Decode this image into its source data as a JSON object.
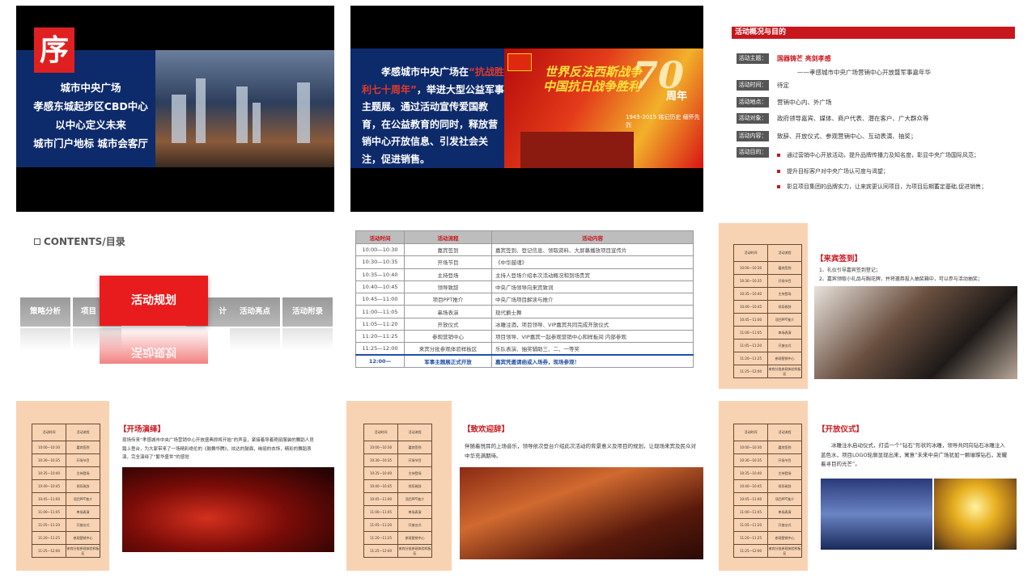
{
  "slide1": {
    "badge": "序",
    "lines": [
      "城市中央广场",
      "孝感东城起步区CBD中心",
      "以中心定义未来",
      "城市门户地标  城市会客厅"
    ]
  },
  "slide2": {
    "text_before": "孝感城市中央广场在",
    "text_red": "“抗战胜利七十周年”",
    "text_after": "，举进大型公益军事主题展。通过活动宣传爱国教育，在公益教育的同时，释放营销中心开放信息、引发社会关注，促进销售。",
    "poster_line1": "世界反法西斯战争",
    "poster_line2": "中国抗日战争胜利",
    "poster_number": "70",
    "poster_suffix": "周年",
    "poster_years": "1945-2015",
    "poster_slogan": "铭记历史 缅怀先烈"
  },
  "slide3": {
    "header": "活动概况与目的",
    "theme_label": "活动主题：",
    "theme_value": "国器铸芒  亮剑孝感",
    "theme_sub": "——孝感城市中央广场营销中心开放暨军事嘉年华",
    "rows": [
      {
        "label": "活动时间：",
        "value": "待定"
      },
      {
        "label": "活动地点：",
        "value": "营销中心内、外广场"
      },
      {
        "label": "活动对象：",
        "value": "政府领导嘉宾、媒体、商户代表、潜在客户、广大群众等"
      },
      {
        "label": "活动内容：",
        "value": "致辞、开放仪式、参观营销中心、互动表演、抽奖；"
      },
      {
        "label": "活动目的：",
        "value": ""
      }
    ],
    "bullets": [
      "通过营销中心开放活动，提升品牌传播力及知名度，彰显中央广场国际风范；",
      "提升目标客户对中央广场认可度与渴望；",
      "彰显项目集团的品牌实力，让来宾更认同项目，为项目后期蓄定基础,促进销售；"
    ]
  },
  "slide4": {
    "title": "CONTENTS/目录",
    "tabs": [
      "策略分析",
      "项目",
      "计",
      "活动亮点",
      "活动附录"
    ],
    "active_tab": "活动规划"
  },
  "slide5": {
    "headers": [
      "活动时间",
      "活动流程",
      "活动内容"
    ],
    "rows": [
      [
        "10:00—10:30",
        "嘉宾签到",
        "嘉宾签到、登记信息、领取资料、大屏幕播放项目宣传片"
      ],
      [
        "10:30—10:35",
        "开场节目",
        "《中华鼓魂》"
      ],
      [
        "10:35—10:40",
        "主持登场",
        "主持人登场介绍本次活动概况和到场贵宾"
      ],
      [
        "10:40—10:45",
        "领导致辞",
        "中央广场领导向来宾致词"
      ],
      [
        "10:45—11:00",
        "项目PPT推介",
        "中央广场项目解读与推介"
      ],
      [
        "11:00—11:05",
        "串场表演",
        "现代爵士舞"
      ],
      [
        "11:05—11:20",
        "开放仪式",
        "冰雕注酒，项目领导、VIP嘉宾共同完成开放仪式"
      ],
      [
        "11:20—11:25",
        "参观营销中心",
        "项目领导、VIP嘉宾一起参观营销中心和样板间 内部参观"
      ],
      [
        "11:25—12:00",
        "来宾分批参观体验样板区",
        "乐队表演、抽奖辅助三、二、一等奖"
      ]
    ],
    "last_row": [
      "12:00—",
      "军事主题展正式开放",
      "嘉宾凭邀请函或入场券，现场参观！"
    ]
  },
  "schedule_mini": {
    "headers": [
      "活动时间",
      "活动流程"
    ],
    "rows": [
      [
        "10:00—10:30",
        "嘉宾签到"
      ],
      [
        "10:30—10:35",
        "开场节目"
      ],
      [
        "10:35—10:40",
        "主持登场"
      ],
      [
        "10:40—10:45",
        "领导致辞"
      ],
      [
        "10:45—11:00",
        "项目PPT推介"
      ],
      [
        "11:00—11:05",
        "串场表演"
      ],
      [
        "11:05—11:20",
        "开放仪式"
      ],
      [
        "11:20—11:25",
        "参观营销中心"
      ],
      [
        "11:25—12:00",
        "来宾分批参观体验样板区"
      ]
    ]
  },
  "slide6": {
    "title": "【来宾签到】",
    "lines": [
      "1、礼仪引导嘉宾签到登记；",
      "2、嘉宾领取小礼品与胸花牌，并将邀券投入抽奖箱中，可以参与活动抽奖；"
    ]
  },
  "slide7": {
    "title": "【开场演绎】",
    "body": "现场传来“孝感城市中央广场营销中心开放盛典即将开始”的声音，紧接着导着艳丽服装的舞蹈人员踏上登台，为大家带来了一场精彩绝伦的《鼓舞华腾》，炫达的鼓面，绚丽的衣饰，精彩的舞蹈表演，完全演绎了“繁华盛世”的感觉"
  },
  "slide8": {
    "title": "【致欢迎辞】",
    "body": "伴随着悦耳的上场音乐，领导依次登台介绍此次活动的背景意义及项目的规划，让现场来宾及民众对中华充满期待。"
  },
  "slide9": {
    "title": "【开放仪式】",
    "body": "冰雕注水启动仪式，打造一个“钻石”形状的冰雕，领导共同向钻石冰雕注入蓝色水，项目LOGO轮廓显现出来，寓意“未来中央广场犹如一颗璀璨钻石，发耀着寻目的光芒”。"
  }
}
